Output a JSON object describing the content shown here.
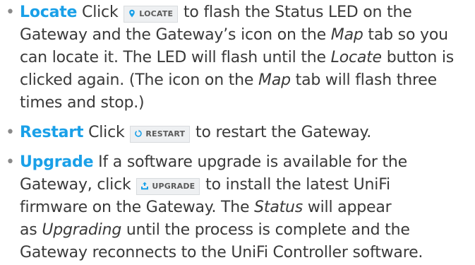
{
  "items": [
    {
      "term": "Locate",
      "l1": [
        " Click ",
        " to flash the Status LED on the"
      ],
      "button": "LOCATE",
      "l2": [
        "Gateway and the Gateway’s icon on the ",
        "Map",
        " tab so you"
      ],
      "l3": [
        "can locate it. The LED will flash until the ",
        "Locate",
        " button is"
      ],
      "l4": [
        "clicked again. (The icon on the ",
        "Map",
        " tab will flash three"
      ],
      "l5": "times and stop.)"
    },
    {
      "term": "Restart",
      "l1": [
        " Click ",
        " to restart the Gateway."
      ],
      "button": "RESTART"
    },
    {
      "term": "Upgrade",
      "l1": " If a software upgrade is available for the",
      "l2": [
        "Gateway, click ",
        " to install the latest UniFi"
      ],
      "button": "UPGRADE",
      "l3": [
        "firmware on the Gateway. The ",
        "Status",
        " will appear"
      ],
      "l4": [
        "as ",
        "Upgrading",
        " until the process is complete and the"
      ],
      "l5": "Gateway reconnects to the UniFi Controller software."
    }
  ],
  "colors": {
    "accent": "#1aa0e8",
    "text": "#3a3a3a",
    "button_bg": "#eef0f2"
  },
  "icons": {
    "locate": "map-pin-icon",
    "restart": "restart-icon",
    "upgrade": "upgrade-icon"
  }
}
